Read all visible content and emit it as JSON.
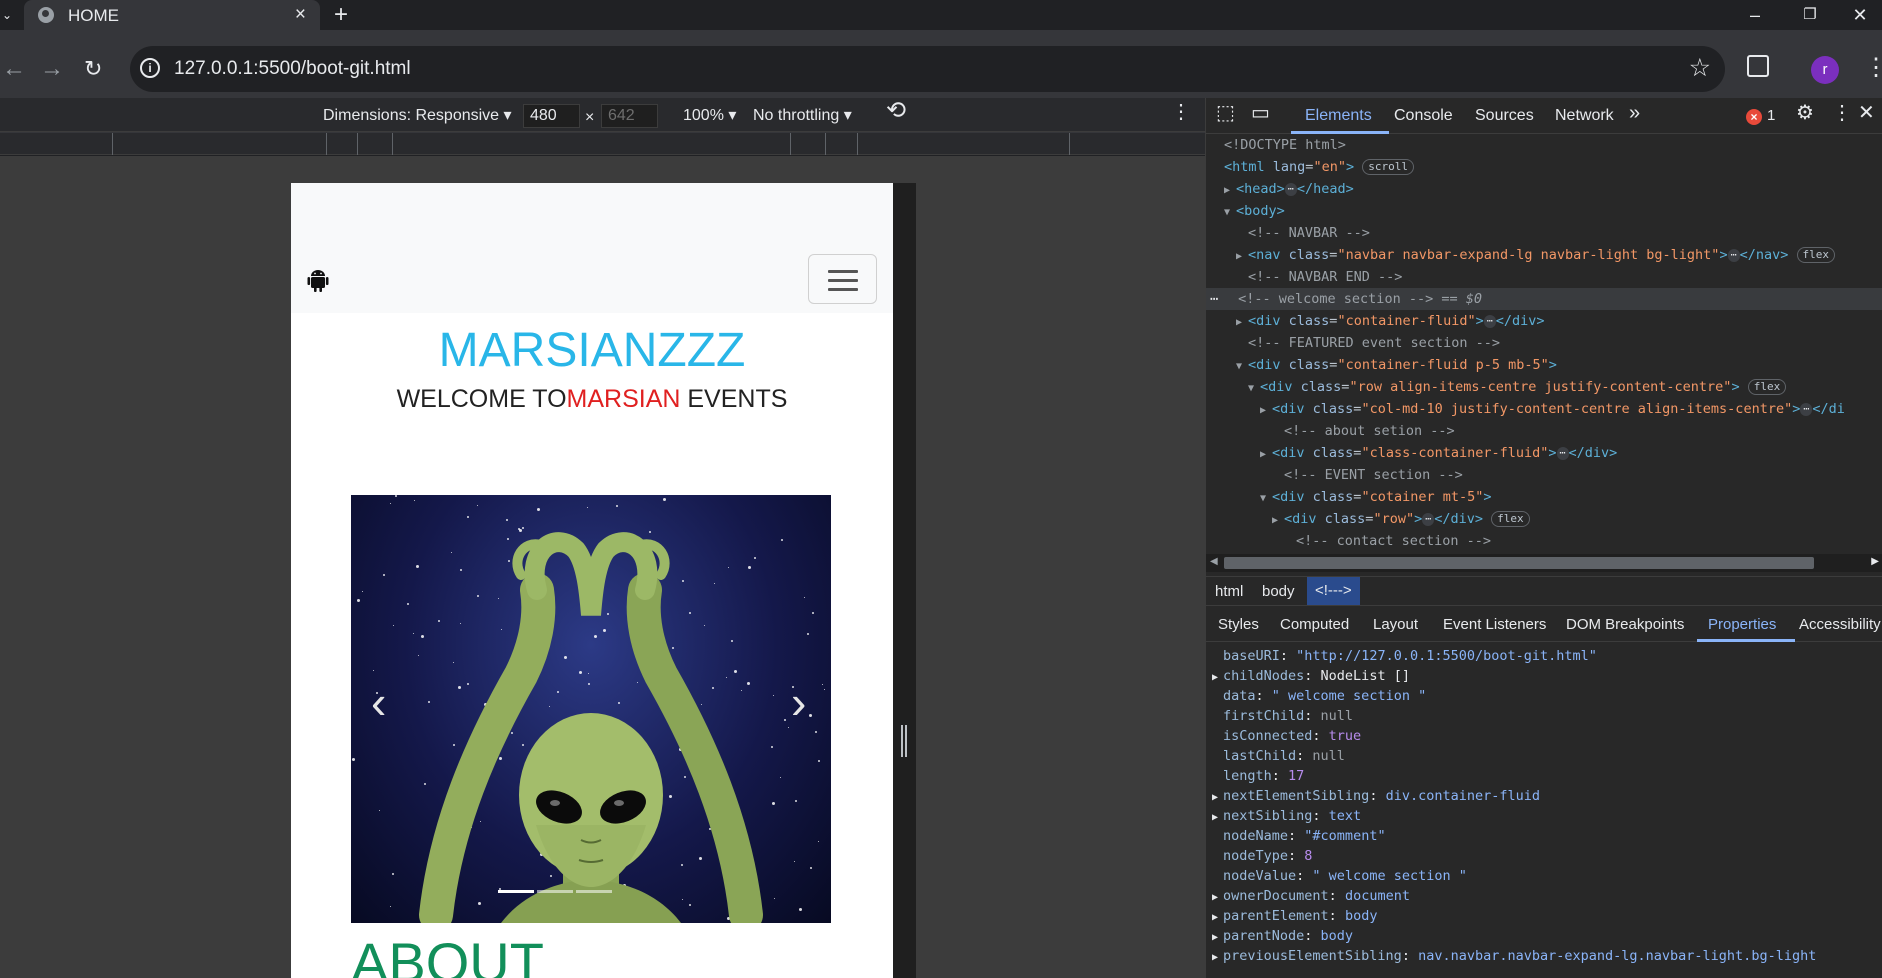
{
  "browser": {
    "tab_title": "HOME",
    "url": "127.0.0.1:5500/boot-git.html",
    "profile_initial": "r"
  },
  "device_toolbar": {
    "dimensions": "Dimensions: Responsive",
    "width": "480",
    "times": "×",
    "height": "642",
    "zoom": "100%",
    "throttling": "No throttling"
  },
  "page": {
    "brand": "MARSIANZZZ",
    "welcome_prefix": "WELCOME TO",
    "welcome_highlight": "MARSIAN",
    "welcome_suffix": " EVENTS",
    "carousel_prev": "‹",
    "carousel_next": "›",
    "about_heading": "ABOUT"
  },
  "devtools": {
    "tabs": [
      "Elements",
      "Console",
      "Sources",
      "Network"
    ],
    "more_tabs": "»",
    "error_count": "1",
    "dom": {
      "doctype": "<!DOCTYPE html>",
      "html_open": "<html",
      "html_lang_attr": "lang",
      "html_lang_val": "\"en\"",
      "scroll_pill": "scroll",
      "head": "<head>",
      "head_close": "</head>",
      "body_open": "<body>",
      "cmt_navbar": "<!-- NAVBAR -->",
      "nav_open": "<nav",
      "class_attr": "class",
      "nav_class_val": "\"navbar navbar-expand-lg navbar-light bg-light\"",
      "nav_close": "</nav>",
      "flex_pill": "flex",
      "cmt_navbar_end": "<!-- NAVBAR END -->",
      "cmt_welcome": "<!-- welcome section -->",
      "selected_marker": "== $0",
      "div_open": "<div",
      "div_close": "</div>",
      "cf_val": "\"container-fluid\"",
      "cmt_featured": "<!--  FEATURED event section -->",
      "cf_p5_val": "\"container-fluid p-5 mb-5\"",
      "row_val": "\"row align-items-centre justify-content-centre\"",
      "col_val": "\"col-md-10 justify-content-centre align-items-centre\"",
      "col_tail": "</di",
      "cmt_about": "<!-- about setion -->",
      "class_cf_val": "\"class-container-fluid\"",
      "cmt_event": "<!-- EVENT section -->",
      "cotainer_val": "\"cotainer mt-5\"",
      "row_short_val": "\"row\"",
      "cmt_contact": "<!-- contact section -->",
      "ellipsis": "⋯",
      "gt": ">"
    },
    "breadcrumbs": [
      "html",
      "body",
      "<!--->"
    ],
    "sub_tabs": [
      "Styles",
      "Computed",
      "Layout",
      "Event Listeners",
      "DOM Breakpoints",
      "Properties",
      "Accessibility"
    ],
    "properties": [
      {
        "key": "baseURI",
        "value": "\"http://127.0.0.1:5500/boot-git.html\"",
        "kind": "str",
        "expandable": false
      },
      {
        "key": "childNodes",
        "value": "NodeList []",
        "kind": "obj",
        "expandable": true
      },
      {
        "key": "data",
        "value": "\" welcome section \"",
        "kind": "str",
        "expandable": false
      },
      {
        "key": "firstChild",
        "value": "null",
        "kind": "null",
        "expandable": false
      },
      {
        "key": "isConnected",
        "value": "true",
        "kind": "num",
        "expandable": false
      },
      {
        "key": "lastChild",
        "value": "null",
        "kind": "null",
        "expandable": false
      },
      {
        "key": "length",
        "value": "17",
        "kind": "num",
        "expandable": false
      },
      {
        "key": "nextElementSibling",
        "value": "div.container-fluid",
        "kind": "str",
        "expandable": true
      },
      {
        "key": "nextSibling",
        "value": "text",
        "kind": "str",
        "expandable": true
      },
      {
        "key": "nodeName",
        "value": "\"#comment\"",
        "kind": "str",
        "expandable": false
      },
      {
        "key": "nodeType",
        "value": "8",
        "kind": "num",
        "expandable": false
      },
      {
        "key": "nodeValue",
        "value": "\" welcome section \"",
        "kind": "str",
        "expandable": false
      },
      {
        "key": "ownerDocument",
        "value": "document",
        "kind": "str",
        "expandable": true
      },
      {
        "key": "parentElement",
        "value": "body",
        "kind": "str",
        "expandable": true
      },
      {
        "key": "parentNode",
        "value": "body",
        "kind": "str",
        "expandable": true
      },
      {
        "key": "previousElementSibling",
        "value": "nav.navbar.navbar-expand-lg.navbar-light.bg-light",
        "kind": "str",
        "expandable": true
      }
    ]
  },
  "icons": {
    "tab_menu": "chevron-down-icon",
    "favicon": "globe-icon",
    "close": "close-icon",
    "new_tab": "plus-icon",
    "back": "arrow-left-icon",
    "forward": "arrow-right-icon",
    "reload": "reload-icon",
    "site_info": "info-icon",
    "bookmark": "star-icon",
    "extensions": "puzzle-icon",
    "android": "android-icon",
    "hamburger": "hamburger-icon"
  }
}
